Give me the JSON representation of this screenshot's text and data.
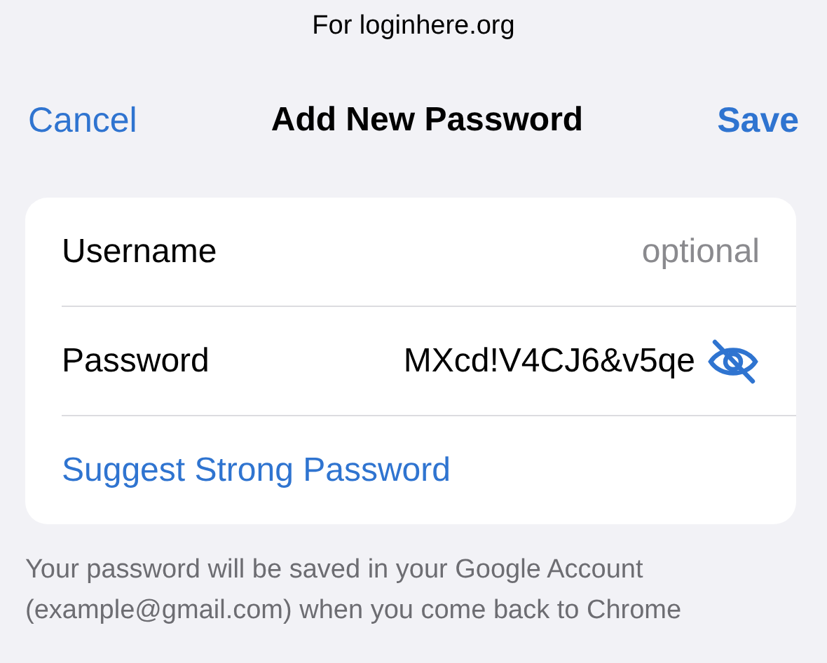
{
  "caption": "For loginhere.org",
  "nav": {
    "cancel": "Cancel",
    "title": "Add New Password",
    "save": "Save"
  },
  "form": {
    "username": {
      "label": "Username",
      "placeholder": "optional"
    },
    "password": {
      "label": "Password",
      "value": "MXcd!V4CJ6&v5qe",
      "visible": true
    },
    "suggest": "Suggest Strong Password"
  },
  "footer": "Your password will be saved in your Google Account (example@gmail.com) when you come back to Chrome"
}
